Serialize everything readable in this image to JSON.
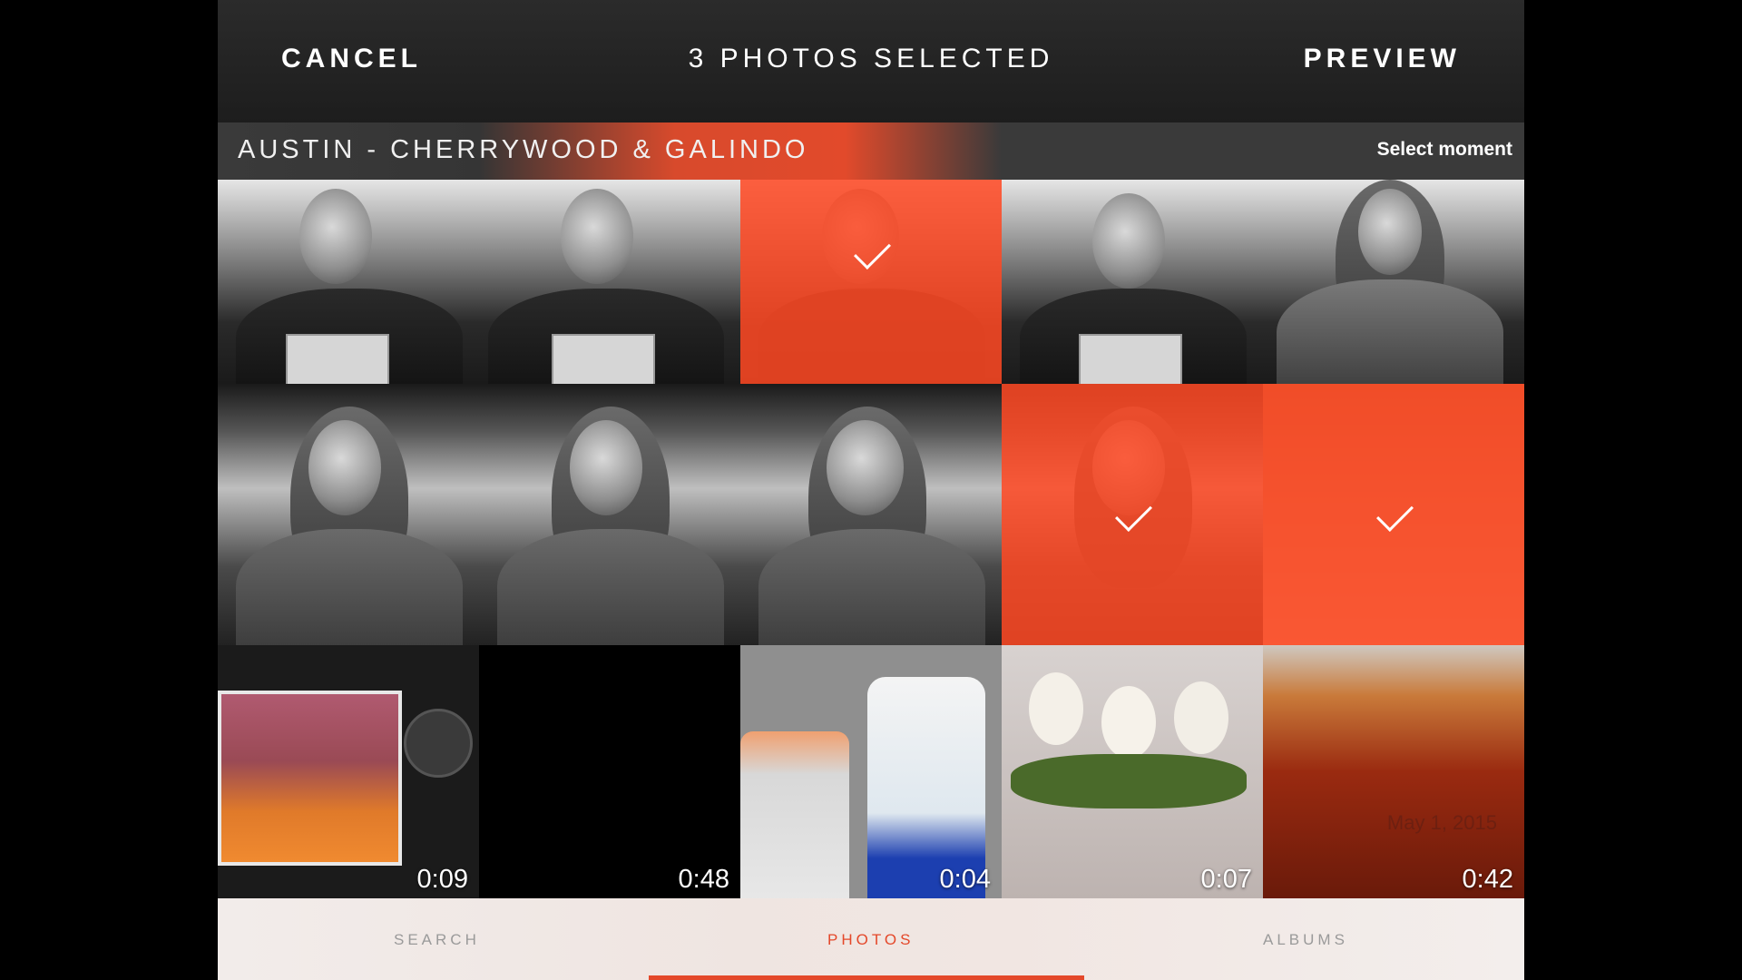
{
  "topbar": {
    "cancel_label": "CANCEL",
    "title": "3 PHOTOS SELECTED",
    "preview_label": "PREVIEW"
  },
  "section": {
    "title": "AUSTIN - CHERRYWOOD & GALINDO",
    "select_label": "Select moment"
  },
  "grid": {
    "items": [
      {
        "kind": "photo",
        "selected": false
      },
      {
        "kind": "photo",
        "selected": false
      },
      {
        "kind": "photo",
        "selected": true
      },
      {
        "kind": "photo",
        "selected": false
      },
      {
        "kind": "photo",
        "selected": false
      },
      {
        "kind": "photo",
        "selected": false
      },
      {
        "kind": "photo",
        "selected": false
      },
      {
        "kind": "photo",
        "selected": false
      },
      {
        "kind": "photo",
        "selected": true
      },
      {
        "kind": "photo",
        "selected": true
      },
      {
        "kind": "video",
        "duration": "0:09"
      },
      {
        "kind": "video",
        "duration": "0:48"
      },
      {
        "kind": "video",
        "duration": "0:04"
      },
      {
        "kind": "video",
        "duration": "0:07"
      },
      {
        "kind": "video",
        "duration": "0:42",
        "date": "May 1, 2015"
      }
    ]
  },
  "tabs": {
    "search": "SEARCH",
    "photos": "PHOTOS",
    "albums": "ALBUMS"
  },
  "colors": {
    "accent": "#e4482a",
    "overlay": "#ff4823"
  }
}
